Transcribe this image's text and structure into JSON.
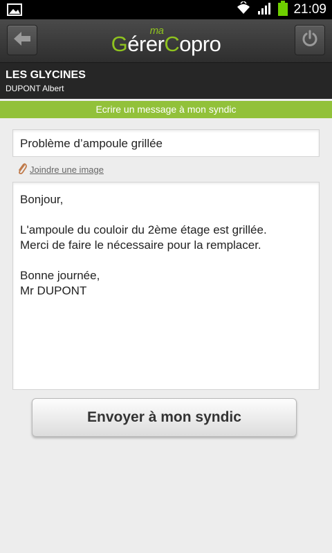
{
  "status_bar": {
    "time": "21:09"
  },
  "app_bar": {
    "logo_g1": "G",
    "logo_rest1": "érer",
    "logo_ma": "ma",
    "logo_g2": "C",
    "logo_rest2": "opro"
  },
  "residence": {
    "name": "LES GLYCINES",
    "owner": "DUPONT Albert"
  },
  "banner": "Ecrire un message à mon syndic",
  "form": {
    "subject": "Problème d’ampoule grillée",
    "attach_label": "Joindre une image",
    "message_lines": [
      "Bonjour,",
      "",
      "L'ampoule du couloir du 2ème étage est grillée.",
      "Merci de faire le nécessaire pour la remplacer.",
      "",
      "Bonne journée,",
      "Mr DUPONT"
    ],
    "send_label": "Envoyer à mon syndic"
  },
  "colors": {
    "accent": "#92c13a",
    "logo_green": "#8fc31f",
    "appbar": "#3a3a3a",
    "subbar": "#262626"
  }
}
